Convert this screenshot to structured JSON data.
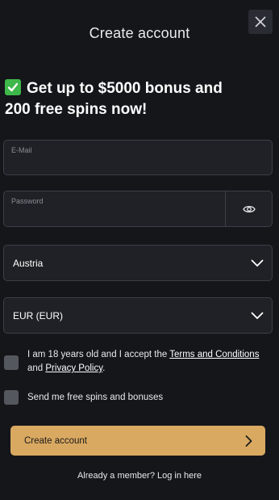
{
  "header": {
    "title": "Create account",
    "close_icon": "close-icon"
  },
  "promo": {
    "icon": "check-mark-emoji",
    "line1": "Get up to $5000 bonus and",
    "line2": "200 free spins now!"
  },
  "form": {
    "email": {
      "label": "E-Mail",
      "value": ""
    },
    "password": {
      "label": "Password",
      "value": "",
      "toggle_icon": "eye-icon"
    },
    "country": {
      "value": "Austria"
    },
    "currency": {
      "value": "EUR (EUR)"
    },
    "age_consent": {
      "text_before": "I am 18 years old and I accept the ",
      "terms_link": "Terms and Conditions",
      "text_middle": "and ",
      "privacy_link": "Privacy Policy",
      "text_after": ".",
      "checked": false
    },
    "marketing_consent": {
      "text": "Send me free spins and bonuses",
      "checked": false
    },
    "submit_label": "Create account"
  },
  "footer": {
    "login_text": "Already a member? Log in here"
  },
  "colors": {
    "background": "#15161a",
    "field_background": "#1f2126",
    "field_border": "#3c3f47",
    "accent_button": "#d9a961",
    "checkbox": "#55575e"
  }
}
